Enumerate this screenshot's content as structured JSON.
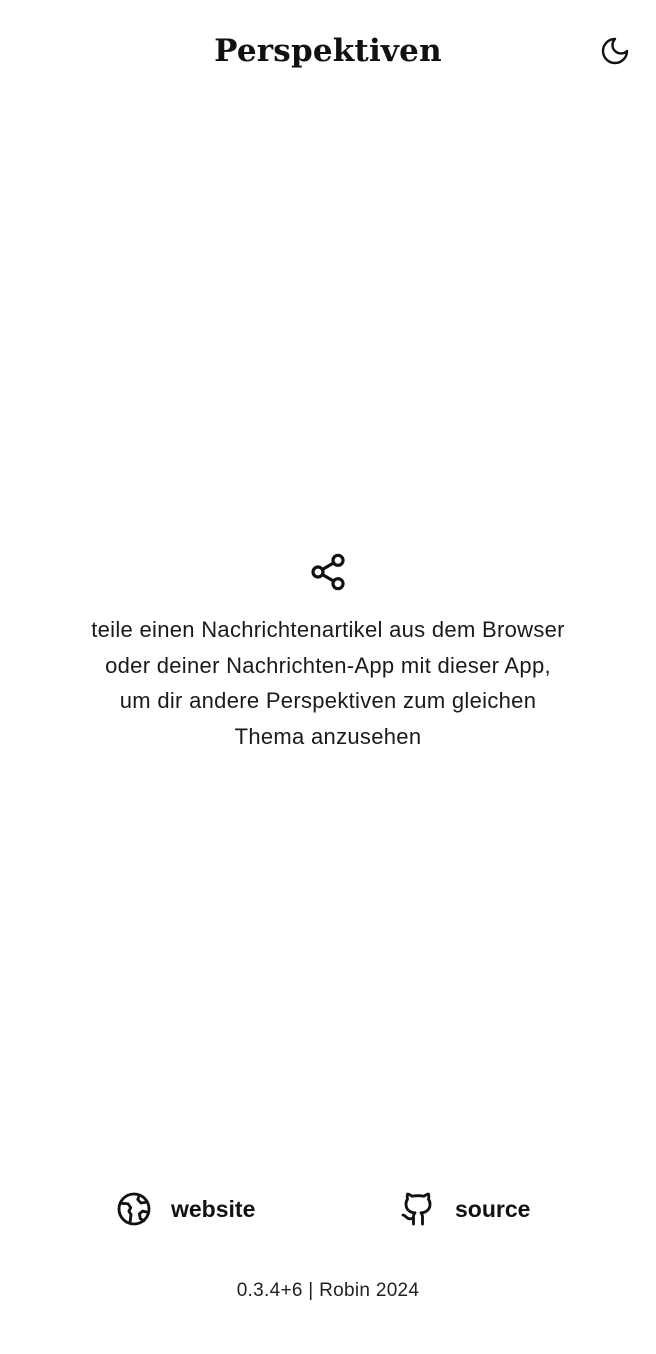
{
  "header": {
    "title": "Perspektiven",
    "theme_toggle_icon": "moon-icon"
  },
  "empty_state": {
    "icon": "share-icon",
    "text": "teile einen Nachrichtenartikel aus dem Browser oder deiner Nachrichten-App mit dieser App, um dir andere Perspektiven zum gleichen Thema anzusehen"
  },
  "links": {
    "website": {
      "label": "website",
      "icon": "globe-icon"
    },
    "source": {
      "label": "source",
      "icon": "github-icon"
    }
  },
  "footer": {
    "version_text": "0.3.4+6 | Robin 2024"
  },
  "colors": {
    "background": "#ffffff",
    "foreground": "#111111"
  }
}
